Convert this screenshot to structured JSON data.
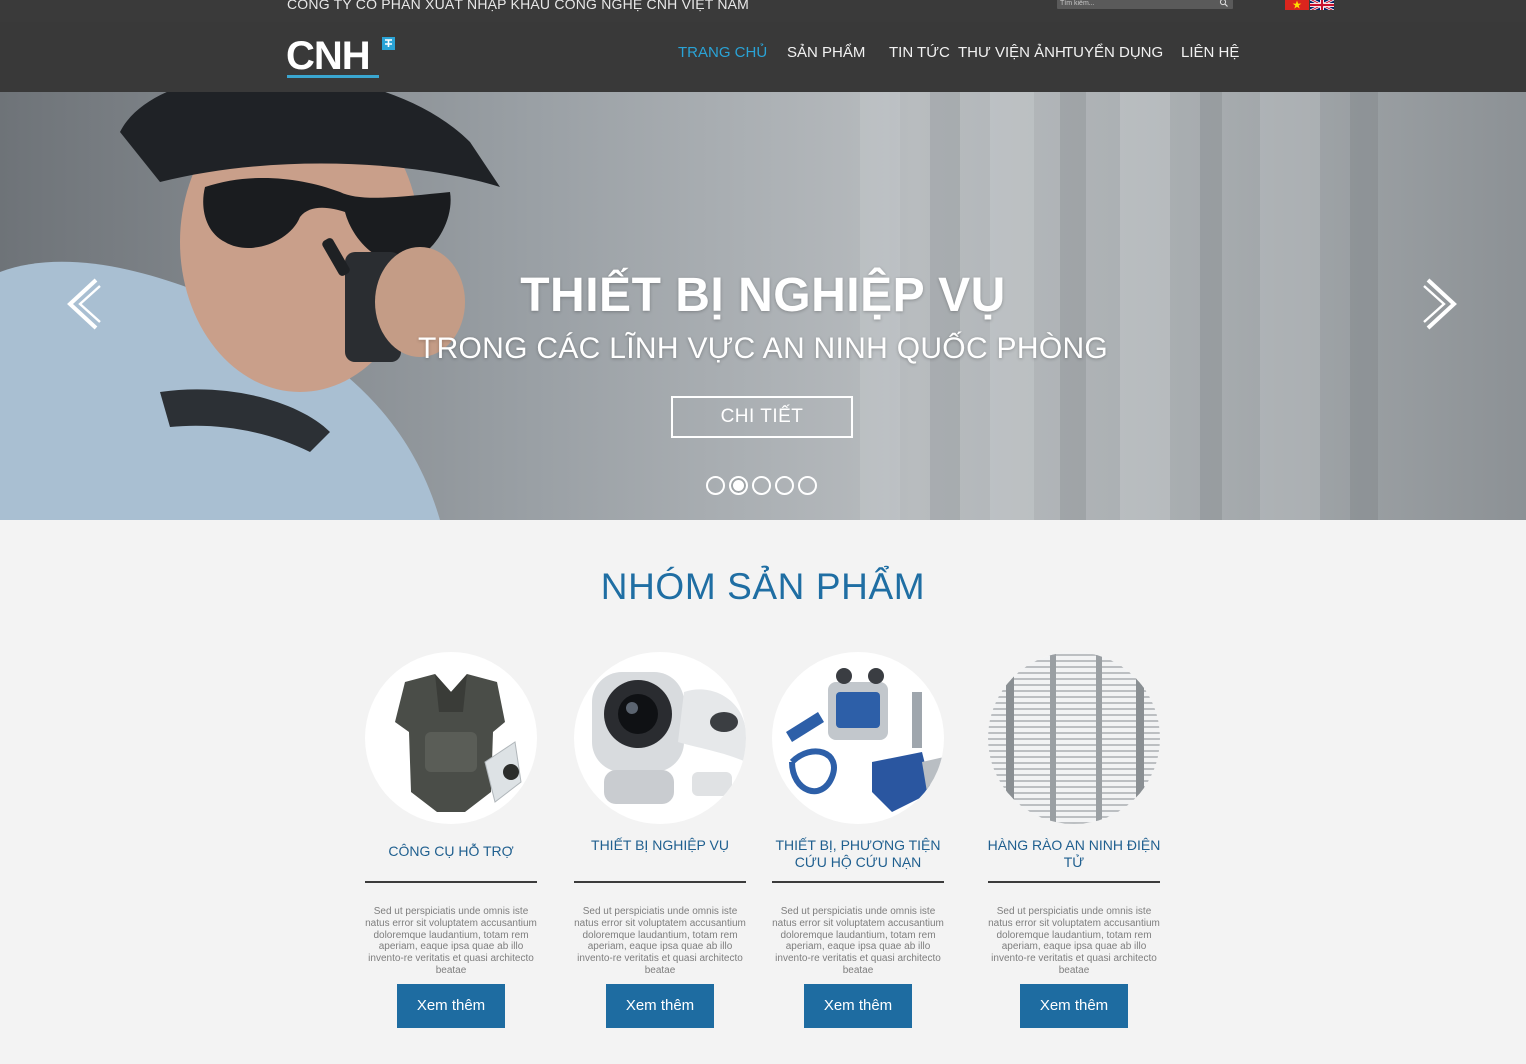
{
  "topbar": {
    "company": "CÔNG TY CỔ PHẦN XUẤT NHẬP KHẨU CÔNG NGHỆ CNH VIỆT NAM",
    "search_placeholder": "Tìm kiếm...",
    "search_icon": "search-icon",
    "languages": [
      "vietnam-flag",
      "uk-flag"
    ]
  },
  "header": {
    "logo": "CNH",
    "nav": [
      {
        "label": "TRANG CHỦ",
        "active": true
      },
      {
        "label": "SẢN PHẨM",
        "active": false
      },
      {
        "label": "TIN TỨC",
        "active": false
      },
      {
        "label": "THƯ VIỆN ẢNH",
        "active": false
      },
      {
        "label": "TUYỂN DỤNG",
        "active": false
      },
      {
        "label": "LIÊN HỆ",
        "active": false
      }
    ]
  },
  "hero": {
    "title": "THIẾT BỊ NGHIỆP VỤ",
    "subtitle": "TRONG CÁC LĨNH VỰC AN NINH QUỐC PHÒNG",
    "button": "CHI TIẾT",
    "slides_total": 5,
    "active_slide": 2,
    "prev_icon": "chevron-left-icon",
    "next_icon": "chevron-right-icon"
  },
  "products": {
    "title": "NHÓM SẢN PHẨM",
    "items": [
      {
        "name": "CÔNG CỤ HỖ TRỢ",
        "desc": "Sed ut perspiciatis unde omnis iste natus error sit voluptatem accusantium doloremque laudantium, totam rem aperiam, eaque ipsa quae ab illo invento-re veritatis et quasi architecto beatae",
        "button": "Xem thêm"
      },
      {
        "name": "THIẾT BỊ NGHIỆP VỤ",
        "desc": "Sed ut perspiciatis unde omnis iste natus error sit voluptatem accusantium doloremque laudantium, totam rem aperiam, eaque ipsa quae ab illo invento-re veritatis et quasi architecto beatae",
        "button": "Xem thêm"
      },
      {
        "name": "THIẾT BỊ, PHƯƠNG TIỆN CỨU HỘ CỨU NẠN",
        "desc": "Sed ut perspiciatis unde omnis iste natus error sit voluptatem accusantium doloremque laudantium, totam rem aperiam, eaque ipsa quae ab illo invento-re veritatis et quasi architecto beatae",
        "button": "Xem thêm"
      },
      {
        "name": "HÀNG RÀO AN NINH ĐIỆN TỬ",
        "desc": "Sed ut perspiciatis unde omnis iste natus error sit voluptatem accusantium doloremque laudantium, totam rem aperiam, eaque ipsa quae ab illo invento-re veritatis et quasi architecto beatae",
        "button": "Xem thêm"
      }
    ]
  },
  "colors": {
    "topbar": "#3a3a3a",
    "navbar": "#393939",
    "nav_active": "#2aa3d6",
    "section_title": "#1f6ea3",
    "button": "#1e6ca1",
    "page_bg": "#f3f3f3"
  }
}
